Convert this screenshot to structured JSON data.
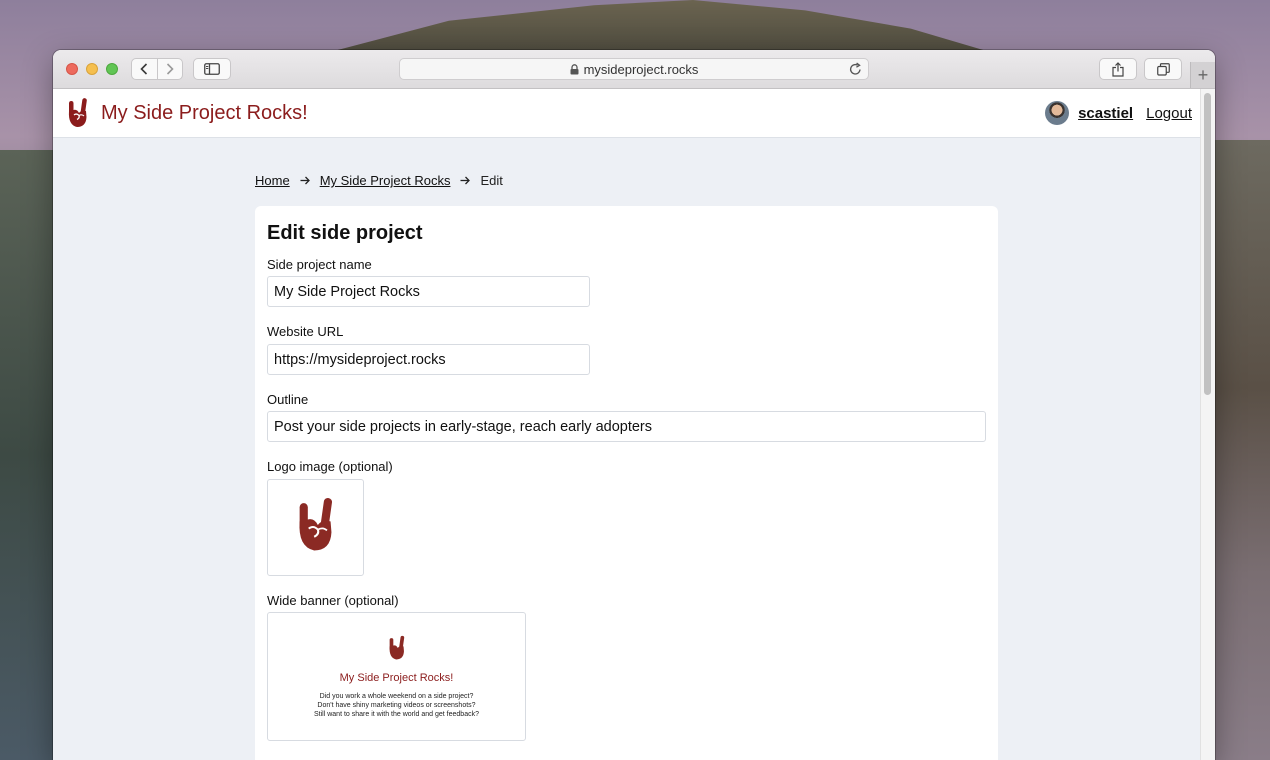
{
  "browser": {
    "url": "mysideproject.rocks",
    "new_tab_symbol": "+"
  },
  "site": {
    "title": "My Side Project Rocks!",
    "username": "scastiel",
    "logout_label": "Logout",
    "brand_color": "#8b1c1c"
  },
  "breadcrumb": {
    "home": "Home",
    "project": "My Side Project Rocks",
    "current": "Edit"
  },
  "form": {
    "heading": "Edit side project",
    "name_label": "Side project name",
    "name_value": "My Side Project Rocks",
    "url_label": "Website URL",
    "url_value": "https://mysideproject.rocks",
    "outline_label": "Outline",
    "outline_value": "Post your side projects in early-stage, reach early adopters",
    "logo_label": "Logo image (optional)",
    "banner_label": "Wide banner (optional)"
  },
  "banner": {
    "title": "My Side Project Rocks!",
    "line1": "Did you work a whole weekend on a side project?",
    "line2": "Don't have shiny marketing videos or screenshots?",
    "line3": "Still want to share it with the world and get feedback?"
  },
  "icons": {
    "logo": "rock-hand-icon",
    "lock": "lock-icon",
    "reload": "reload-icon"
  }
}
